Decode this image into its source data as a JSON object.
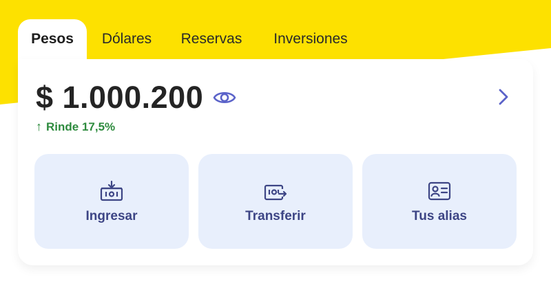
{
  "tabs": [
    {
      "label": "Pesos",
      "active": true
    },
    {
      "label": "Dólares",
      "active": false
    },
    {
      "label": "Reservas",
      "active": false
    },
    {
      "label": "Inversiones",
      "active": false
    }
  ],
  "balance": {
    "amount": "$ 1.000.200",
    "yield_label": "Rinde 17,5%"
  },
  "actions": [
    {
      "label": "Ingresar",
      "icon": "deposit-icon"
    },
    {
      "label": "Transferir",
      "icon": "transfer-icon"
    },
    {
      "label": "Tus alias",
      "icon": "alias-card-icon"
    }
  ],
  "colors": {
    "brand_yellow": "#fde100",
    "accent_indigo": "#5b63c9",
    "action_text": "#3d4585",
    "action_bg": "#e8effc",
    "positive_green": "#2e8b3e"
  }
}
